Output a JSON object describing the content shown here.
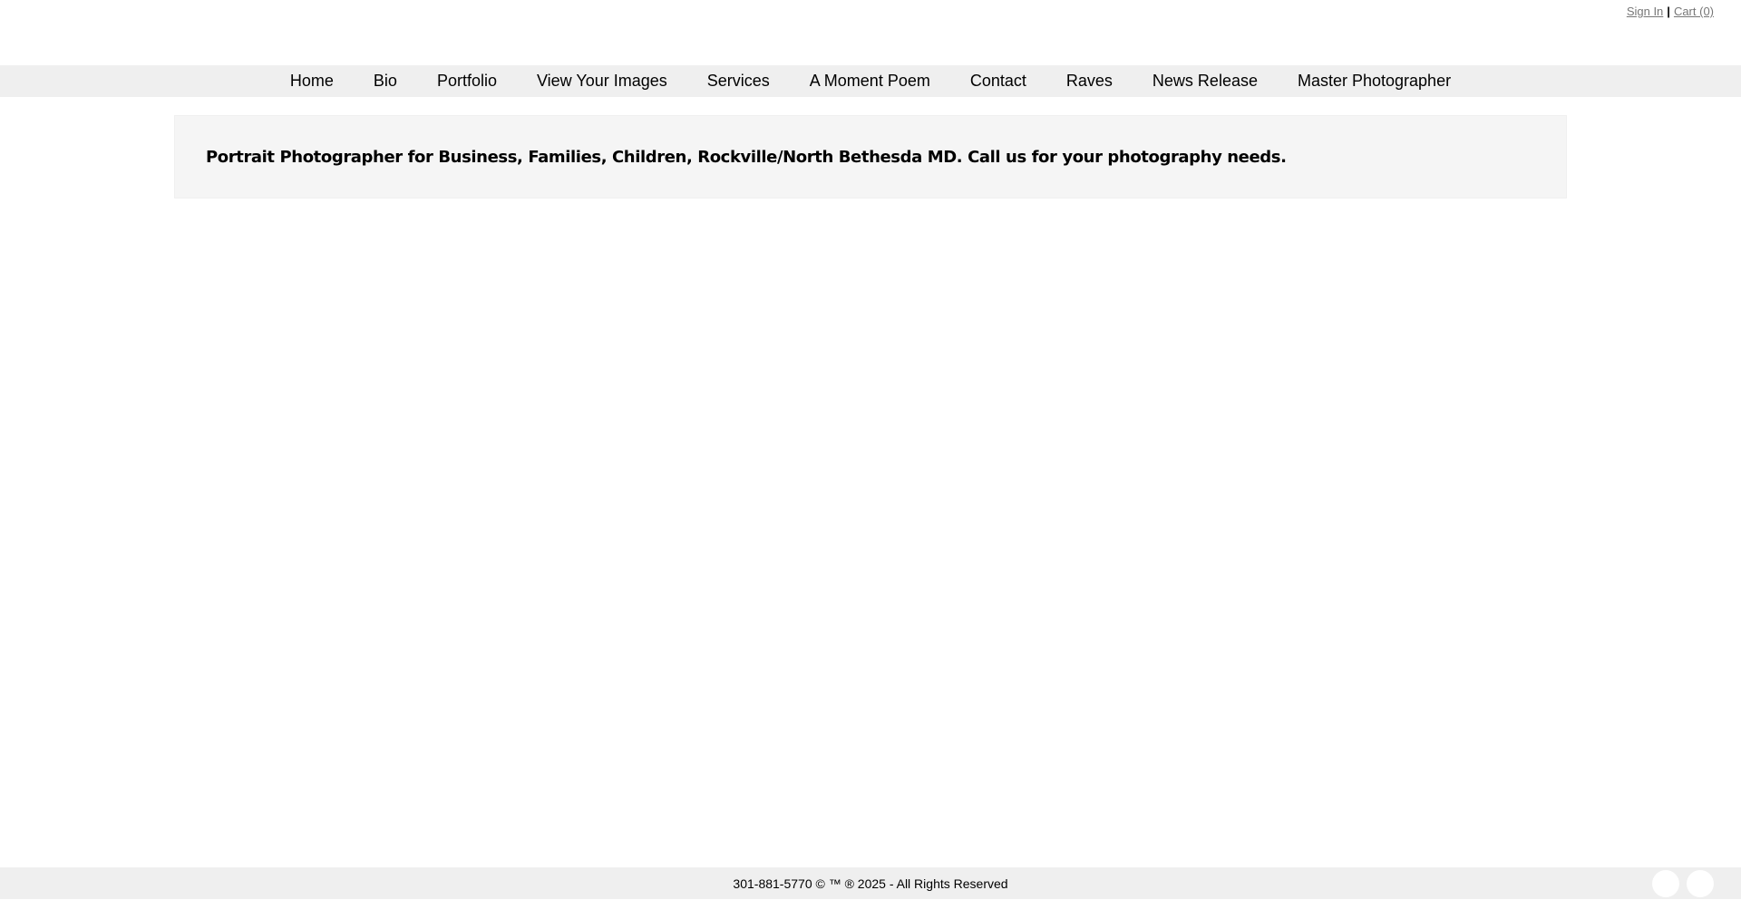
{
  "utility": {
    "sign_in": "Sign In",
    "separator": "|",
    "cart": "Cart (0)"
  },
  "nav": {
    "items": [
      {
        "label": "Home"
      },
      {
        "label": "Bio"
      },
      {
        "label": "Portfolio"
      },
      {
        "label": "View Your Images"
      },
      {
        "label": "Services"
      },
      {
        "label": "A Moment Poem"
      },
      {
        "label": "Contact"
      },
      {
        "label": "Raves"
      },
      {
        "label": "News Release"
      },
      {
        "label": "Master Photographer"
      }
    ]
  },
  "main": {
    "tagline": "Portrait Photographer for Business, Families, Children, Rockville/North Bethesda MD. Call us for your photography needs."
  },
  "footer": {
    "text": "301-881-5770 © ™ ® 2025 - All Rights Reserved",
    "icons": [
      "social-icon",
      "social-icon"
    ]
  },
  "colors": {
    "nav_background": "#efefef",
    "tagline_background": "#f5f5f5",
    "link_gray": "#777777"
  }
}
